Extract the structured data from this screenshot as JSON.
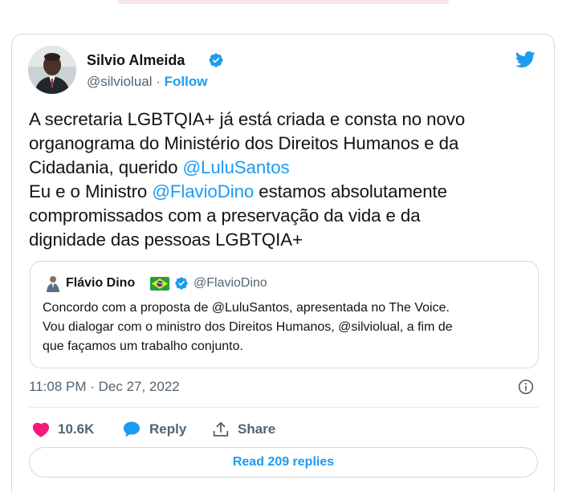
{
  "tweet": {
    "author": {
      "name": "Silvio Almeida",
      "handle": "@silviolual",
      "separator": "·",
      "follow_label": "Follow"
    },
    "text_lines": [
      {
        "before": "A secretaria LGBTQIA+ já está criada e consta no novo",
        "mention": "",
        "after": ""
      },
      {
        "before": "organograma do Ministério dos Direitos Humanos e da",
        "mention": "",
        "after": ""
      },
      {
        "before": "Cidadania, querido ",
        "mention": "@LuluSantos",
        "after": ""
      },
      {
        "before": "Eu e o Ministro ",
        "mention": "@FlavioDino",
        "after": " estamos absolutamente"
      },
      {
        "before": "compromissados com a preservação da vida e da",
        "mention": "",
        "after": ""
      },
      {
        "before": "dignidade das pessoas LGBTQIA+",
        "mention": "",
        "after": ""
      }
    ],
    "quoted": {
      "name": "Flávio Dino",
      "handle": "@FlavioDino",
      "text_lines": [
        "Concordo com a proposta de @LuluSantos, apresentada no The Voice.",
        "Vou dialogar com o ministro dos Direitos Humanos, @silviolual, a fim de",
        "que façamos um trabalho conjunto."
      ]
    },
    "timestamp": "11:08 PM · Dec 27, 2022",
    "actions": {
      "likes": "10.6K",
      "reply_label": "Reply",
      "share_label": "Share"
    },
    "read_replies_label": "Read 209 replies"
  },
  "colors": {
    "accent": "#1d9bf0",
    "like": "#f91880",
    "text": "#0f1419",
    "muted": "#536471",
    "border": "#cfd9de"
  },
  "icons": [
    "verified-badge-icon",
    "twitter-bird-icon",
    "brazil-flag-icon",
    "info-icon",
    "heart-icon",
    "reply-bubble-icon",
    "share-icon"
  ]
}
